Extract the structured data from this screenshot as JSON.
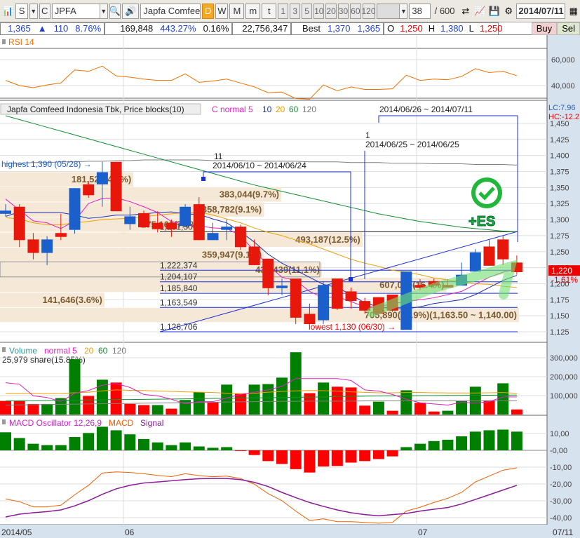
{
  "toolbar": {
    "market": "S",
    "code_prefix": "C",
    "symbol": "JPFA",
    "company": "Japfa Comfeed I",
    "periods": [
      "D",
      "W",
      "M",
      "m",
      "t"
    ],
    "active_period": "D",
    "intervals": [
      "1",
      "3",
      "5",
      "10",
      "20",
      "30",
      "60",
      "120"
    ],
    "count": "38",
    "total": "/ 600",
    "date": "2014/07/11"
  },
  "info": {
    "price": "1,365",
    "change_arrow": "▲",
    "change": "110",
    "change_pct": "8.76%",
    "volume": "169,848",
    "volume_pct": "443.27%",
    "turnover_pct": "0.16%",
    "amount": "22,756,347",
    "best_label": "Best",
    "best_ask": "1,370",
    "best_bid": "1,365",
    "open_label": "O",
    "open": "1,250",
    "high_label": "H",
    "high": "1,380",
    "low_label": "L",
    "low": "1,250",
    "buy": "Buy",
    "sell": "Sel"
  },
  "colors": {
    "up": "#e8170c",
    "down": "#1a5fcc",
    "ma5": "#e020c0",
    "ma10": "#1a2fb0",
    "ma20": "#f0a000",
    "ma60": "#109030",
    "ma120": "#808080",
    "block": "#f5e8d6"
  },
  "rsi": {
    "title": "RSI 14",
    "ticks": [
      "60,000",
      "40,000"
    ],
    "tick_values": [
      60,
      40
    ],
    "values": [
      44,
      40,
      38.4,
      40.5,
      42,
      52,
      51,
      55,
      47.5,
      46.5,
      45,
      44,
      44,
      49,
      42.5,
      43.5,
      45,
      42,
      39,
      34.5,
      35,
      30,
      29.5,
      40.5,
      36,
      39,
      37,
      37,
      37.5,
      48,
      44,
      45,
      44.5,
      47,
      53,
      50,
      51,
      47.6
    ]
  },
  "price": {
    "legend_title": "Japfa Comfeed Indonesia Tbk, Price blocks(10)",
    "legend_ma": [
      "C normal 5",
      "10",
      "20",
      "60",
      "120"
    ],
    "lc": "LC:7.96",
    "hc": "HC:-12.2",
    "current": "1,220",
    "current_value": 1220,
    "current_pct": "-1.61%",
    "ticks": [
      "1,450",
      "1,425",
      "1,400",
      "1,375",
      "1,350",
      "1,325",
      "1,300",
      "1,275",
      "1,250",
      "1,225",
      "1,200",
      "1,175",
      "1,150",
      "1,125"
    ],
    "tick_values": [
      1450,
      1425,
      1400,
      1375,
      1350,
      1325,
      1300,
      1275,
      1250,
      1225,
      1200,
      1175,
      1150,
      1125
    ],
    "candles": [
      [
        1314,
        1324,
        1305,
        1309
      ],
      [
        1268,
        1324,
        1257,
        1320
      ],
      [
        1248,
        1279,
        1238,
        1269
      ],
      [
        1269,
        1274,
        1229,
        1248
      ],
      [
        1273,
        1309,
        1268,
        1279
      ],
      [
        1349,
        1349,
        1278,
        1284
      ],
      [
        1338,
        1360,
        1334,
        1355
      ],
      [
        1374,
        1390,
        1320,
        1355
      ],
      [
        1313,
        1390,
        1313,
        1390
      ],
      [
        1305,
        1320,
        1284,
        1293
      ],
      [
        1288,
        1314,
        1288,
        1310
      ],
      [
        1285,
        1313,
        1280,
        1295
      ],
      [
        1285,
        1300,
        1273,
        1295
      ],
      [
        1320,
        1324,
        1290,
        1290
      ],
      [
        1268,
        1335,
        1268,
        1324
      ],
      [
        1279,
        1295,
        1268,
        1268
      ],
      [
        1289,
        1300,
        1268,
        1284
      ],
      [
        1257,
        1292,
        1253,
        1289
      ],
      [
        1229,
        1269,
        1229,
        1258
      ],
      [
        1193,
        1239,
        1182,
        1239
      ],
      [
        1197,
        1208,
        1182,
        1193
      ],
      [
        1147,
        1208,
        1137,
        1208
      ],
      [
        1137,
        1169,
        1137,
        1153
      ],
      [
        1198,
        1204,
        1137,
        1143
      ],
      [
        1161,
        1208,
        1159,
        1208
      ],
      [
        1173,
        1194,
        1161,
        1188
      ],
      [
        1158,
        1178,
        1153,
        1173
      ],
      [
        1153,
        1179,
        1153,
        1179
      ],
      [
        1158,
        1183,
        1156,
        1183
      ],
      [
        1219,
        1219,
        1130,
        1128
      ],
      [
        1194,
        1207,
        1190,
        1198
      ],
      [
        1197,
        1208,
        1193,
        1204
      ],
      [
        1194,
        1207,
        1194,
        1198
      ],
      [
        1214,
        1233,
        1197,
        1197
      ],
      [
        1249,
        1254,
        1219,
        1219
      ],
      [
        1228,
        1268,
        1228,
        1258
      ],
      [
        1238,
        1275,
        1229,
        1269
      ],
      [
        1218,
        1244,
        1214,
        1233
      ]
    ],
    "ma5": [
      1332,
      1315,
      1298,
      1295,
      1286,
      1298,
      1325,
      1333,
      1334,
      1328,
      1320,
      1311,
      1297,
      1292,
      1290,
      1287,
      1286,
      1275,
      1251,
      1229,
      1210,
      1205,
      1188,
      1178,
      1180,
      1172,
      1164,
      1164,
      1169,
      1172,
      1175,
      1178,
      1183,
      1188,
      1199,
      1210,
      1218,
      1223
    ],
    "ma10": [
      1305,
      1312,
      1311,
      1311,
      1311,
      1307,
      1302,
      1304,
      1307,
      1307,
      1309,
      1311,
      1312,
      1309,
      1308,
      1301,
      1295,
      1281,
      1265,
      1246,
      1232,
      1221,
      1210,
      1199,
      1194,
      1183,
      1170,
      1164,
      1161,
      1161,
      1164,
      1169,
      1172,
      1175,
      1183,
      1194,
      1205,
      1213
    ],
    "ma20": [
      1303,
      1301,
      1295,
      1292,
      1292,
      1295,
      1297,
      1300,
      1301,
      1302,
      1304,
      1307,
      1309,
      1311,
      1312,
      1307,
      1301,
      1295,
      1287,
      1280,
      1275,
      1268,
      1262,
      1254,
      1246,
      1238,
      1232,
      1227,
      1221,
      1218,
      1214,
      1209,
      1206,
      1203,
      1200,
      1199,
      1196,
      1194
    ],
    "ma60": [
      1462,
      1456,
      1450,
      1444,
      1438,
      1432,
      1426,
      1420,
      1414,
      1408,
      1402,
      1396,
      1390,
      1384,
      1378,
      1372,
      1366,
      1360,
      1354,
      1349,
      1344,
      1339,
      1334,
      1329,
      1324,
      1319,
      1314,
      1309,
      1305,
      1301,
      1297,
      1294,
      1291,
      1288,
      1286,
      1284,
      1282,
      1281
    ],
    "ma120": [
      1388,
      1388,
      1389,
      1389,
      1390,
      1390,
      1391,
      1391,
      1392,
      1392,
      1393,
      1393,
      1393,
      1393,
      1393,
      1392,
      1392,
      1392,
      1391,
      1391,
      1391,
      1391,
      1390,
      1390,
      1390,
      1389,
      1389,
      1389,
      1388,
      1388,
      1388,
      1387,
      1387,
      1387,
      1386,
      1386,
      1386,
      1385
    ],
    "blocks": [
      {
        "label": "181,527(4.6%)",
        "pct": 4.6,
        "from": 1351.5,
        "to": 1375
      },
      {
        "label": "383,044(9.7%)",
        "pct": 9.7,
        "from": 1328,
        "to": 1351.5
      },
      {
        "label": "358,782(9.1%)",
        "pct": 9.1,
        "from": 1304.5,
        "to": 1328
      },
      {
        "label": "275,166(7.0%)",
        "pct": 7.0,
        "from": 1281,
        "to": 1304.5
      },
      {
        "label": "493,187(12.5%)",
        "pct": 12.5,
        "from": 1257.5,
        "to": 1281
      },
      {
        "label": "359,947(9.1%)",
        "pct": 9.1,
        "from": 1234,
        "to": 1257.5
      },
      {
        "label": "436,439(11.1%)",
        "pct": 11.1,
        "from": 1210.5,
        "to": 1234,
        "selected": true
      },
      {
        "label": "607,085(15.4%)",
        "pct": 15.4,
        "from": 1187,
        "to": 1210.5
      },
      {
        "label": "141,646(3.6%)",
        "pct": 3.6,
        "from": 1163.5,
        "to": 1187
      },
      {
        "label": "705,890(17.9%)(1,163.50 ~ 1,140.00)",
        "pct": 17.9,
        "from": 1140,
        "to": 1163.5
      }
    ],
    "levels": [
      {
        "label": "1,281,506",
        "price": 1281
      },
      {
        "label": "1,222,374",
        "price": 1221
      },
      {
        "label": "1,204,107",
        "price": 1203
      },
      {
        "label": "1,185,840",
        "price": 1185
      },
      {
        "label": "1,163,549",
        "price": 1163
      },
      {
        "label": "1,126,706",
        "price": 1125
      }
    ],
    "highest": "highest 1,390 (05/28) →",
    "lowest": "lowest 1,130 (06/30) →",
    "periods": [
      {
        "count": "11",
        "range": "2014/06/10 ~ 2014/06/24"
      },
      {
        "count": "1",
        "range": "2014/06/25 ~ 2014/06/25"
      },
      {
        "count": "",
        "range": "2014/06/26 ~ 2014/07/11"
      }
    ],
    "signal_text": "+ES"
  },
  "volume": {
    "legend": [
      "Volume",
      "normal 5",
      "20",
      "60",
      "120"
    ],
    "info": "25,979 share(15.85%)",
    "ticks": [
      "300,000",
      "200,000",
      "100,000"
    ],
    "tick_values": [
      300000,
      200000,
      100000
    ],
    "bars": [
      72000,
      72000,
      56000,
      56000,
      87000,
      292000,
      98000,
      184000,
      169000,
      56000,
      50000,
      50000,
      31000,
      77000,
      118000,
      65000,
      158000,
      109000,
      158000,
      161000,
      195000,
      329000,
      113000,
      169000,
      147000,
      143000,
      47000,
      68000,
      20000,
      128000,
      62000,
      16000,
      20000,
      71000,
      147000,
      75000,
      165000,
      27000
    ],
    "bar_colors": [
      "r",
      "r",
      "r",
      "g",
      "g",
      "g",
      "r",
      "g",
      "r",
      "r",
      "r",
      "g",
      "r",
      "g",
      "g",
      "r",
      "g",
      "r",
      "g",
      "g",
      "g",
      "g",
      "r",
      "g",
      "r",
      "r",
      "r",
      "g",
      "r",
      "g",
      "r",
      "r",
      "g",
      "g",
      "g",
      "r",
      "g",
      "r"
    ],
    "ma5": [
      168000,
      160000,
      99000,
      90000,
      68000,
      112000,
      127000,
      155000,
      164000,
      143000,
      106000,
      99000,
      81000,
      56000,
      68000,
      68000,
      87000,
      106000,
      118000,
      130000,
      149000,
      190000,
      190000,
      190000,
      190000,
      180000,
      130000,
      124000,
      106000,
      81000,
      62000,
      56000,
      50000,
      65000,
      60000,
      68000,
      93000,
      93000
    ],
    "ma20": [
      112000,
      112000,
      112000,
      111000,
      112000,
      115000,
      118000,
      125000,
      130000,
      128000,
      127000,
      124000,
      122000,
      120000,
      118000,
      116000,
      113000,
      110000,
      112000,
      118000,
      122000,
      125000,
      127000,
      126000,
      124000,
      120000,
      117000,
      115000,
      115000,
      116000,
      116000,
      115000,
      114000,
      114000,
      114000,
      115000,
      116000,
      112000
    ],
    "ma60": [
      72000,
      72000,
      73000,
      74000,
      75000,
      76000,
      77000,
      78000,
      79000,
      79000,
      80000,
      81000,
      82000,
      83000,
      84000,
      85000,
      86000,
      87000,
      88000,
      89000,
      90000,
      91000,
      92000,
      93000,
      95000,
      96000,
      97000,
      98000,
      99000,
      99000,
      100000,
      100000,
      101000,
      101000,
      102000,
      102000,
      103000,
      103000
    ],
    "ma120": [
      50000,
      51000,
      52000,
      53000,
      54000,
      55000,
      56000,
      57000,
      58000,
      59000,
      60000,
      61000,
      62000,
      63000,
      64000,
      65000,
      66000,
      67000,
      68000,
      69000,
      70000,
      70000,
      71000,
      71000,
      71000,
      71000,
      72000,
      72000,
      72000,
      72000,
      72000,
      72000,
      72000,
      72000,
      72000,
      72000,
      72000,
      72000
    ]
  },
  "macd": {
    "legend": [
      "MACD Oscillator 12,26,9",
      "MACD",
      "Signal"
    ],
    "ticks": [
      "10,00",
      "-0,00",
      "-10,00",
      "-20,00",
      "-30,00",
      "-40,00"
    ],
    "tick_values": [
      10,
      0,
      -10,
      -20,
      -30,
      -40
    ],
    "osc": [
      10.7,
      7.3,
      3.9,
      3.1,
      3.1,
      7.9,
      10.3,
      14,
      11.9,
      9.5,
      6.7,
      4.7,
      3.1,
      4.7,
      2.3,
      1.5,
      1.9,
      -0.4,
      -2.8,
      -6.4,
      -8.1,
      -11.2,
      -13.2,
      -9.6,
      -9.3,
      -7.3,
      -6.4,
      -5.2,
      -3.6,
      1.9,
      3.9,
      5.5,
      6.3,
      8.3,
      11.1,
      11.9,
      12.3,
      11.1
    ],
    "macd": [
      -28.9,
      -30.5,
      -33.6,
      -33.6,
      -32.6,
      -26.4,
      -20.8,
      -13.5,
      -12.8,
      -13.2,
      -13.9,
      -14.9,
      -15.6,
      -13.9,
      -15,
      -15.7,
      -15.3,
      -16.7,
      -20.1,
      -25.7,
      -29.9,
      -36.1,
      -41.7,
      -40.7,
      -42.4,
      -42.4,
      -42.8,
      -43.3,
      -42.8,
      -36.1,
      -33.8,
      -31,
      -28.5,
      -25,
      -18.8,
      -15.3,
      -11.8,
      -10.4
    ],
    "signal": [
      -39.6,
      -37.9,
      -37.1,
      -36.4,
      -35.4,
      -33,
      -29.9,
      -26.1,
      -22.9,
      -20.8,
      -19.4,
      -18.8,
      -18.1,
      -17.4,
      -16.9,
      -16.7,
      -16.7,
      -17.4,
      -19,
      -21.5,
      -25,
      -28.1,
      -31,
      -33.3,
      -35.4,
      -37.1,
      -38.2,
      -38.9,
      -38.2,
      -37.5,
      -36.1,
      -35,
      -34,
      -31.9,
      -29.2,
      -26.4,
      -23.6,
      -20.8
    ]
  },
  "xaxis": {
    "labels": [
      "2014/05",
      "06",
      "07"
    ],
    "end": "07/11"
  }
}
